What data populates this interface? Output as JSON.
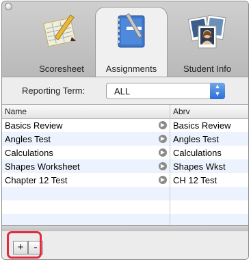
{
  "tabs": [
    {
      "label": "Scoresheet",
      "icon": "scoresheet-icon"
    },
    {
      "label": "Assignments",
      "icon": "assignments-notebook-icon",
      "active": true
    },
    {
      "label": "Student Info",
      "icon": "student-photos-icon"
    }
  ],
  "reporting_term": {
    "label": "Reporting Term:",
    "value": "ALL"
  },
  "table": {
    "columns": [
      "Name",
      "Abrv"
    ],
    "rows": [
      {
        "name": "Basics Review",
        "abrv": "Basics Review"
      },
      {
        "name": "Angles Test",
        "abrv": "Angles Test"
      },
      {
        "name": "Calculations",
        "abrv": "Calculations"
      },
      {
        "name": "Shapes Worksheet",
        "abrv": "Shapes Wkst"
      },
      {
        "name": "Chapter 12 Test",
        "abrv": "CH 12 Test"
      }
    ]
  },
  "buttons": {
    "add": "+",
    "remove": "-"
  },
  "colors": {
    "highlight": "#e22a3c",
    "select_accent": "#2b6ed8"
  }
}
